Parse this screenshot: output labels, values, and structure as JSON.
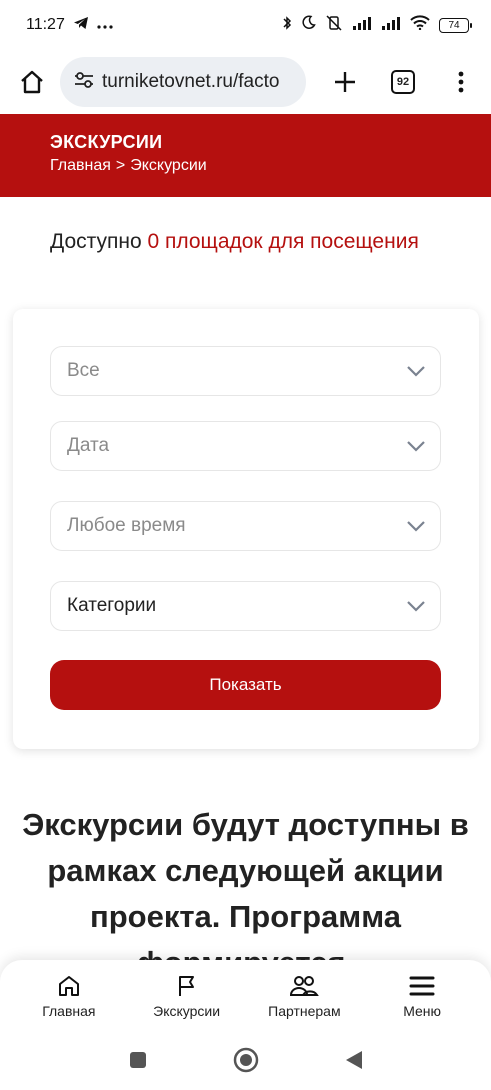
{
  "status_bar": {
    "time": "11:27",
    "battery": "74"
  },
  "browser": {
    "url": "turniketovnet.ru/facto",
    "tabs_count": "92"
  },
  "header": {
    "title": "ЭКСКУРСИИ",
    "breadcrumb": {
      "home": "Главная",
      "separator": ">",
      "current": "Экскурсии"
    }
  },
  "available": {
    "prefix": "Доступно ",
    "count_text": "0 площадок для посещения"
  },
  "filters": {
    "type_select": "Все",
    "date_select": "Дата",
    "time_select": "Любое время",
    "category_select": "Категории",
    "show_button": "Показать"
  },
  "info": {
    "heading": "Экскурсии будут доступны в рамках следующей акции проекта. Программа формируется."
  },
  "bottom_nav": {
    "items": [
      {
        "label": "Главная",
        "icon": "home-icon"
      },
      {
        "label": "Экскурсии",
        "icon": "flag-icon"
      },
      {
        "label": "Партнерам",
        "icon": "partners-icon"
      },
      {
        "label": "Меню",
        "icon": "menu-icon"
      }
    ]
  },
  "colors": {
    "accent": "#b5100f",
    "url_bg": "#eceff3"
  }
}
